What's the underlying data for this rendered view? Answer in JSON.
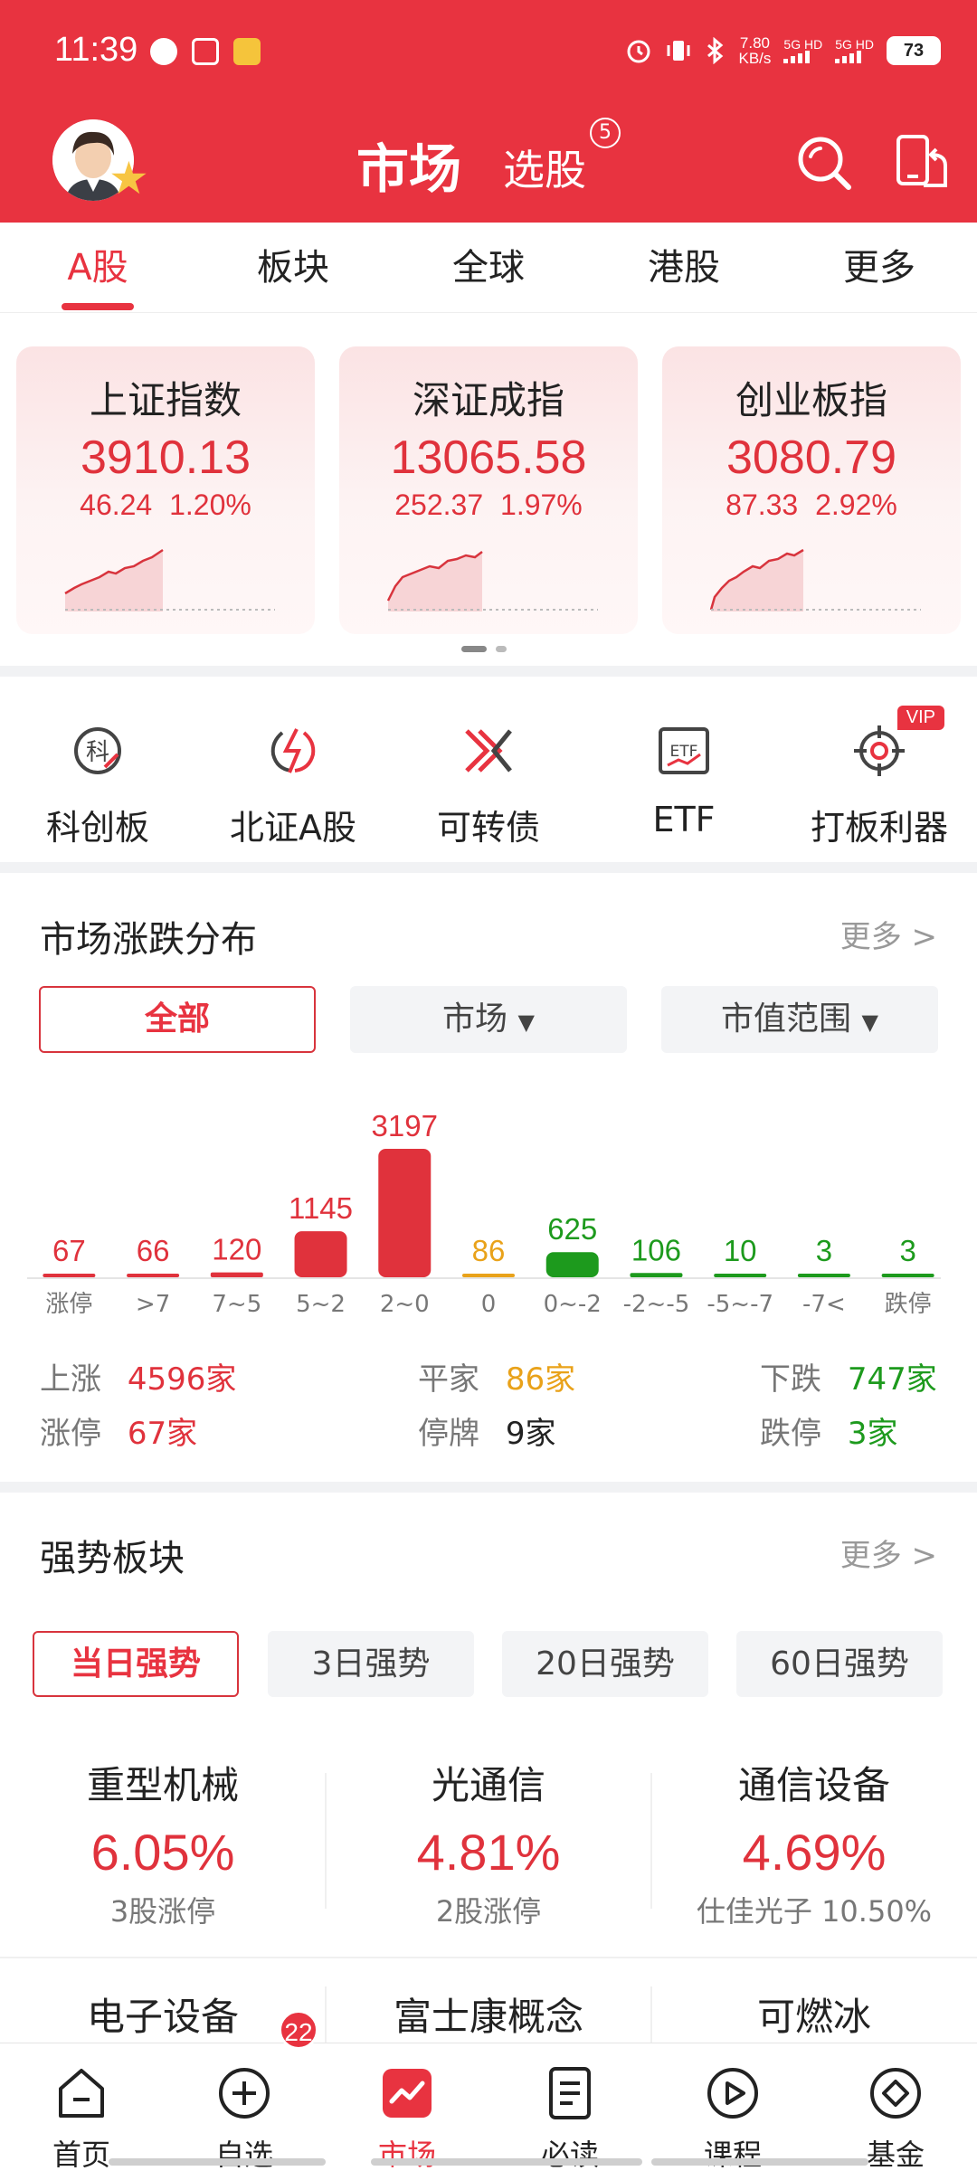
{
  "status_bar": {
    "time": "11:39",
    "net_speed": "7.80",
    "net_unit": "KB/s",
    "sim1": "5G HD",
    "sim2": "5G HD",
    "battery": "73"
  },
  "header": {
    "title": "市场",
    "subtitle": "选股",
    "pick_badge": "5"
  },
  "tabs": [
    "A股",
    "板块",
    "全球",
    "港股",
    "更多"
  ],
  "indices": [
    {
      "name": "上证指数",
      "value": "3910.13",
      "change": "46.24",
      "pct": "1.20%"
    },
    {
      "name": "深证成指",
      "value": "13065.58",
      "change": "252.37",
      "pct": "1.97%"
    },
    {
      "name": "创业板指",
      "value": "3080.79",
      "change": "87.33",
      "pct": "2.92%"
    }
  ],
  "quick": [
    {
      "label": "科创板",
      "icon": "kechuang-icon"
    },
    {
      "label": "北证A股",
      "icon": "beizheng-icon"
    },
    {
      "label": "可转债",
      "icon": "convertible-bond-icon"
    },
    {
      "label": "ETF",
      "icon": "etf-icon"
    },
    {
      "label": "打板利器",
      "icon": "target-icon",
      "badge": "VIP"
    }
  ],
  "distribution": {
    "title": "市场涨跌分布",
    "more": "更多 >",
    "filters": [
      "全部",
      "市场",
      "市值范围"
    ],
    "stats": {
      "up_label": "上涨",
      "up_value": "4596家",
      "flat_label": "平家",
      "flat_value": "86家",
      "down_label": "下跌",
      "down_value": "747家",
      "limit_up_label": "涨停",
      "limit_up_value": "67家",
      "halt_label": "停牌",
      "halt_value": "9家",
      "limit_down_label": "跌停",
      "limit_down_value": "3家"
    }
  },
  "chart_data": {
    "type": "bar",
    "categories": [
      "涨停",
      ">7",
      "7~5",
      "5~2",
      "2~0",
      "0",
      "0~-2",
      "-2~-5",
      "-5~-7",
      "-7<",
      "跌停"
    ],
    "values": [
      67,
      66,
      120,
      1145,
      3197,
      86,
      625,
      106,
      10,
      3,
      3
    ],
    "colors": [
      "#e0323c",
      "#e0323c",
      "#e0323c",
      "#e0323c",
      "#e0323c",
      "#e9a21a",
      "#1d9a1d",
      "#1d9a1d",
      "#1d9a1d",
      "#1d9a1d",
      "#1d9a1d"
    ]
  },
  "strong": {
    "title": "强势板块",
    "more": "更多 >",
    "filters": [
      "当日强势",
      "3日强势",
      "20日强势",
      "60日强势"
    ],
    "sectors": [
      {
        "name": "重型机械",
        "pct": "6.05%",
        "desc": "3股涨停"
      },
      {
        "name": "光通信",
        "pct": "4.81%",
        "desc": "2股涨停"
      },
      {
        "name": "通信设备",
        "pct": "4.69%",
        "desc": "仕佳光子 10.50%"
      },
      {
        "name": "电子设备"
      },
      {
        "name": "富士康概念"
      },
      {
        "name": "可燃冰"
      }
    ]
  },
  "bottom_nav": [
    {
      "label": "首页",
      "icon": "home-icon"
    },
    {
      "label": "自选",
      "icon": "add-watchlist-icon",
      "badge": "22"
    },
    {
      "label": "市场",
      "icon": "market-icon"
    },
    {
      "label": "必读",
      "icon": "document-icon"
    },
    {
      "label": "课程",
      "icon": "play-icon"
    },
    {
      "label": "基金",
      "icon": "fund-icon"
    }
  ],
  "accent_color": "#e83340"
}
